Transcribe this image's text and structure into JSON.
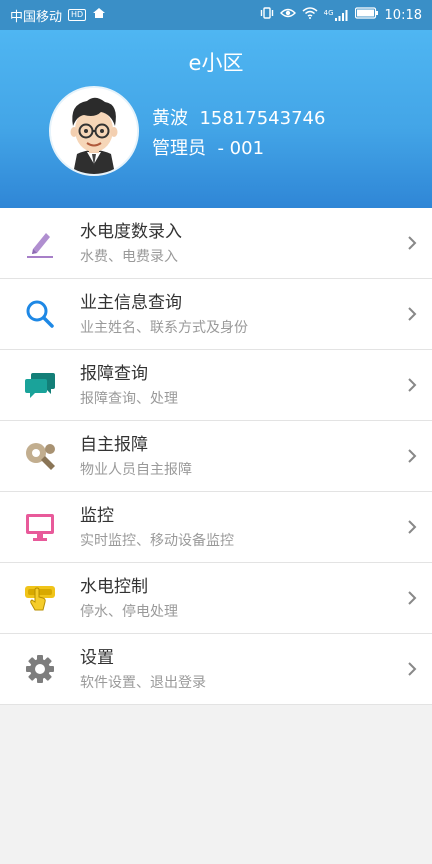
{
  "statusbar": {
    "carrier": "中国移动",
    "hd_badge": "HD",
    "signal_badge": "4G",
    "time": "10:18"
  },
  "header": {
    "title": "e小区",
    "user_name": "黄波",
    "phone": "15817543746",
    "role": "管理员",
    "role_id": "- 001"
  },
  "menu": [
    {
      "title": "水电度数录入",
      "subtitle": "水费、电费录入",
      "icon": "pencil-icon",
      "color": "#a77fc8"
    },
    {
      "title": "业主信息查询",
      "subtitle": "业主姓名、联系方式及身份",
      "icon": "search-icon",
      "color": "#1e88e5"
    },
    {
      "title": "报障查询",
      "subtitle": "报障查询、处理",
      "icon": "chat-bubbles-icon",
      "color": "#1aa39a"
    },
    {
      "title": "自主报障",
      "subtitle": "物业人员自主报障",
      "icon": "wrench-icon",
      "color": "#b9a486"
    },
    {
      "title": "监控",
      "subtitle": "实时监控、移动设备监控",
      "icon": "monitor-icon",
      "color": "#e85a9a"
    },
    {
      "title": "水电控制",
      "subtitle": "停水、停电处理",
      "icon": "tap-control-icon",
      "color": "#f0c419"
    },
    {
      "title": "设置",
      "subtitle": "软件设置、退出登录",
      "icon": "gear-icon",
      "color": "#7d7d7d"
    }
  ]
}
